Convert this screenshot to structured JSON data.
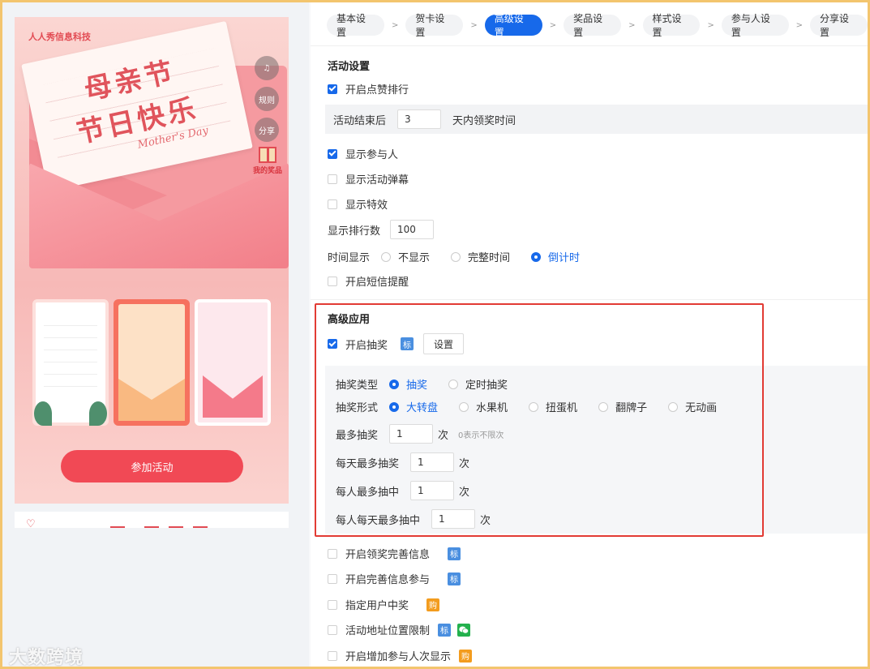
{
  "preview": {
    "company": "人人秀信息科技",
    "title_line1": "母亲节",
    "title_line2": "节日快乐",
    "title_en": "Mother's Day",
    "side_music": "♫",
    "side_rules": "规则",
    "side_share": "分享",
    "side_prize": "我的奖品",
    "join_button": "参加活动"
  },
  "watermark": "大数跨境",
  "steps": [
    {
      "label": "基本设置",
      "active": false
    },
    {
      "label": "贺卡设置",
      "active": false
    },
    {
      "label": "高级设置",
      "active": true
    },
    {
      "label": "奖品设置",
      "active": false
    },
    {
      "label": "样式设置",
      "active": false
    },
    {
      "label": "参与人设置",
      "active": false
    },
    {
      "label": "分享设置",
      "active": false
    }
  ],
  "activity": {
    "section_title": "活动设置",
    "like_rank": {
      "label": "开启点赞排行",
      "checked": true
    },
    "end_prefix": "活动结束后",
    "end_days": "3",
    "end_suffix": "天内领奖时间",
    "show_participants": {
      "label": "显示参与人",
      "checked": true
    },
    "show_danmaku": {
      "label": "显示活动弹幕",
      "checked": false
    },
    "show_effects": {
      "label": "显示特效",
      "checked": false
    },
    "rank_count_label": "显示排行数",
    "rank_count": "100",
    "time_display_label": "时间显示",
    "time_options": [
      "不显示",
      "完整时间",
      "倒计时"
    ],
    "time_selected": "倒计时",
    "sms": {
      "label": "开启短信提醒",
      "checked": false
    }
  },
  "advanced": {
    "section_title": "高级应用",
    "lottery": {
      "label": "开启抽奖",
      "checked": true,
      "tag": "标",
      "settings_button": "设置"
    },
    "type_label": "抽奖类型",
    "type_options": [
      "抽奖",
      "定时抽奖"
    ],
    "type_selected": "抽奖",
    "form_label": "抽奖形式",
    "form_options": [
      "大转盘",
      "水果机",
      "扭蛋机",
      "翻牌子",
      "无动画"
    ],
    "form_selected": "大转盘",
    "max_draw_label": "最多抽奖",
    "max_draw": "1",
    "unit": "次",
    "max_draw_hint": "0表示不限次",
    "daily_draw_label": "每天最多抽奖",
    "daily_draw": "1",
    "per_person_win_label": "每人最多抽中",
    "per_person_win": "1",
    "per_person_daily_win_label": "每人每天最多抽中",
    "per_person_daily_win": "1"
  },
  "more": [
    {
      "label": "开启领奖完善信息",
      "tag": "标",
      "tag_color": "#4a8fe0"
    },
    {
      "label": "开启完善信息参与",
      "tag": "标",
      "tag_color": "#4a8fe0"
    },
    {
      "label": "指定用户中奖",
      "tag": "购",
      "tag_color": "#f39c1e"
    },
    {
      "label": "活动地址位置限制",
      "tag": "标",
      "tag_color": "#4a8fe0",
      "extra_icon": "wechat-icon"
    },
    {
      "label": "开启增加参与人次显示",
      "tag": "购",
      "tag_color": "#f39c1e"
    }
  ],
  "colors": {
    "accent": "#1769ea",
    "highlight_border": "#e23b34",
    "join_button": "#f14955"
  }
}
